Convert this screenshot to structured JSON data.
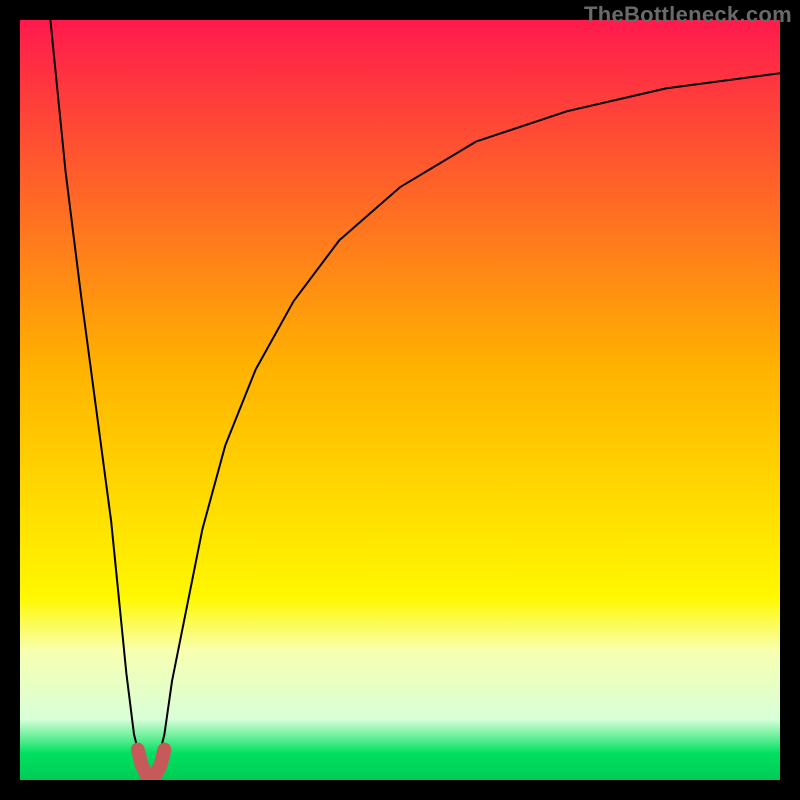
{
  "watermark": "TheBottleneck.com",
  "chart_data": {
    "type": "line",
    "title": "",
    "xlabel": "",
    "ylabel": "",
    "xlim": [
      0,
      100
    ],
    "ylim": [
      0,
      100
    ],
    "gradient_bands": [
      {
        "y": 0,
        "color": "#ff1a4d"
      },
      {
        "y": 46,
        "color": "#ffb300"
      },
      {
        "y": 76,
        "color": "#fff800"
      },
      {
        "y": 83,
        "color": "#f8ffb0"
      },
      {
        "y": 92,
        "color": "#d8ffd8"
      },
      {
        "y": 96.5,
        "color": "#00e060"
      },
      {
        "y": 100,
        "color": "#00cc55"
      }
    ],
    "notch_x": 17,
    "series": [
      {
        "name": "bottleneck-curve",
        "x": [
          4,
          6,
          8,
          10,
          12,
          13,
          14,
          15,
          16,
          17,
          18,
          19,
          20,
          22,
          24,
          27,
          31,
          36,
          42,
          50,
          60,
          72,
          85,
          100
        ],
        "y": [
          100,
          80,
          64,
          49,
          34,
          24,
          14,
          6,
          2,
          0,
          2,
          6,
          13,
          23,
          33,
          44,
          54,
          63,
          71,
          78,
          84,
          88,
          91,
          93
        ]
      },
      {
        "name": "notch-marker",
        "x": [
          15.5,
          16.0,
          16.5,
          17.0,
          17.5,
          18.0,
          18.5,
          19.0
        ],
        "y": [
          4,
          2,
          1,
          0,
          0,
          1,
          2,
          4
        ]
      }
    ],
    "annotations": []
  }
}
